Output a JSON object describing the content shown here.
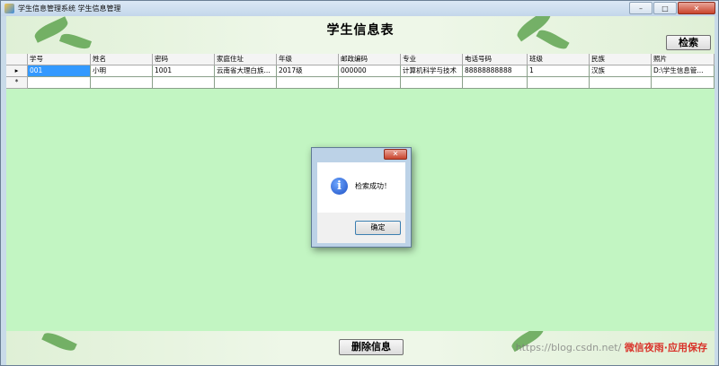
{
  "window": {
    "title": "学生信息管理系统 学生信息管理",
    "minimize": "–",
    "maximize": "□",
    "close": "✕"
  },
  "header": {
    "title": "学生信息表",
    "search_button": "检索"
  },
  "table": {
    "columns": [
      "学号",
      "姓名",
      "密码",
      "家庭住址",
      "年级",
      "邮政编码",
      "专业",
      "电话号码",
      "班级",
      "民族",
      "照片"
    ],
    "row": {
      "marker": "▸",
      "cells": [
        "001",
        "小明",
        "1001",
        "云南省大理白族...",
        "2017级",
        "000000",
        "计算机科学与技术",
        "88888888888",
        "1",
        "汉族",
        "D:\\学生信息管..."
      ]
    },
    "new_row": {
      "marker": "*"
    }
  },
  "dialog": {
    "close": "✕",
    "icon": "i",
    "message": "检索成功！",
    "ok_button": "确定"
  },
  "footer": {
    "delete_button": "删除信息",
    "watermark_url": "https://blog.csdn.net/",
    "watermark_brand": "微信夜雨·应用保存"
  },
  "colors": {
    "grid_background": "#c2f5c2",
    "selected_cell": "#3399ff",
    "leaf": "#4e9a3e"
  }
}
